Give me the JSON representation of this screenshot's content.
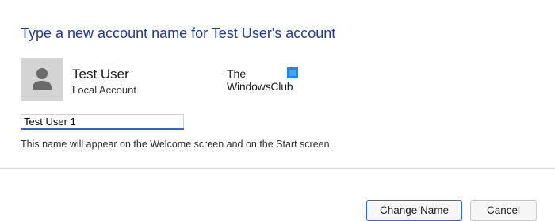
{
  "dialog": {
    "heading": "Type a new account name for Test User's account"
  },
  "account": {
    "name": "Test User",
    "type": "Local Account",
    "avatar_icon": "person-icon"
  },
  "watermark": {
    "line1": "The",
    "line2": "WindowsClub"
  },
  "name_field": {
    "value": "Test User 1"
  },
  "hint": "This name will appear on the Welcome screen and on the Start screen.",
  "buttons": {
    "change_name": "Change Name",
    "cancel": "Cancel"
  },
  "colors": {
    "heading": "#1f3a93",
    "accent": "#2c67c9",
    "avatar_bg": "#d4d4d4"
  }
}
